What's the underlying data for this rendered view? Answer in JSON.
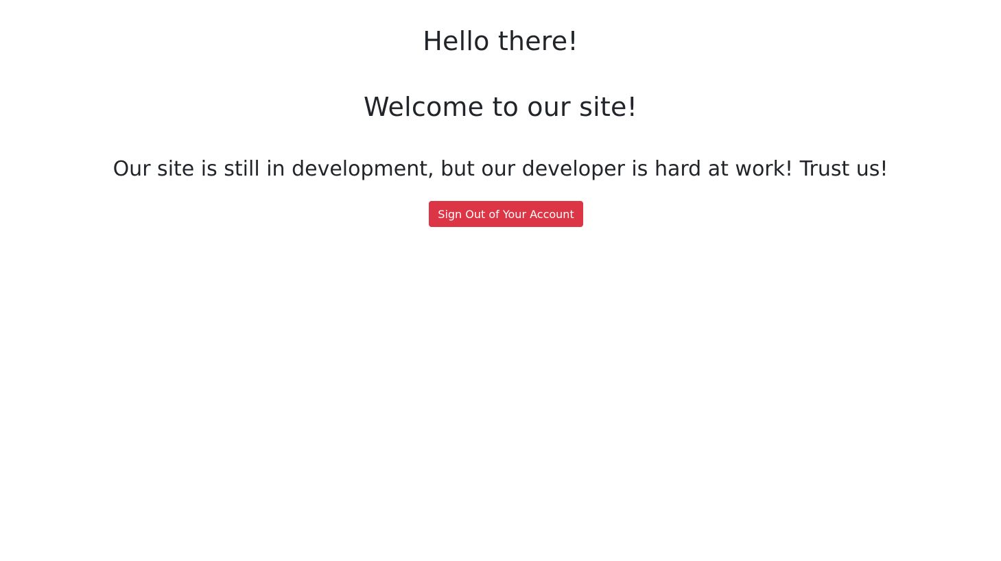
{
  "page": {
    "greeting": "Hello there!",
    "welcome": "Welcome to our site!",
    "status_message": "Our site is still in development, but our developer is hard at work! Trust us!",
    "sign_out_label": "Sign Out of Your Account"
  },
  "colors": {
    "text": "#212529",
    "danger": "#dc3545",
    "background": "#ffffff"
  }
}
